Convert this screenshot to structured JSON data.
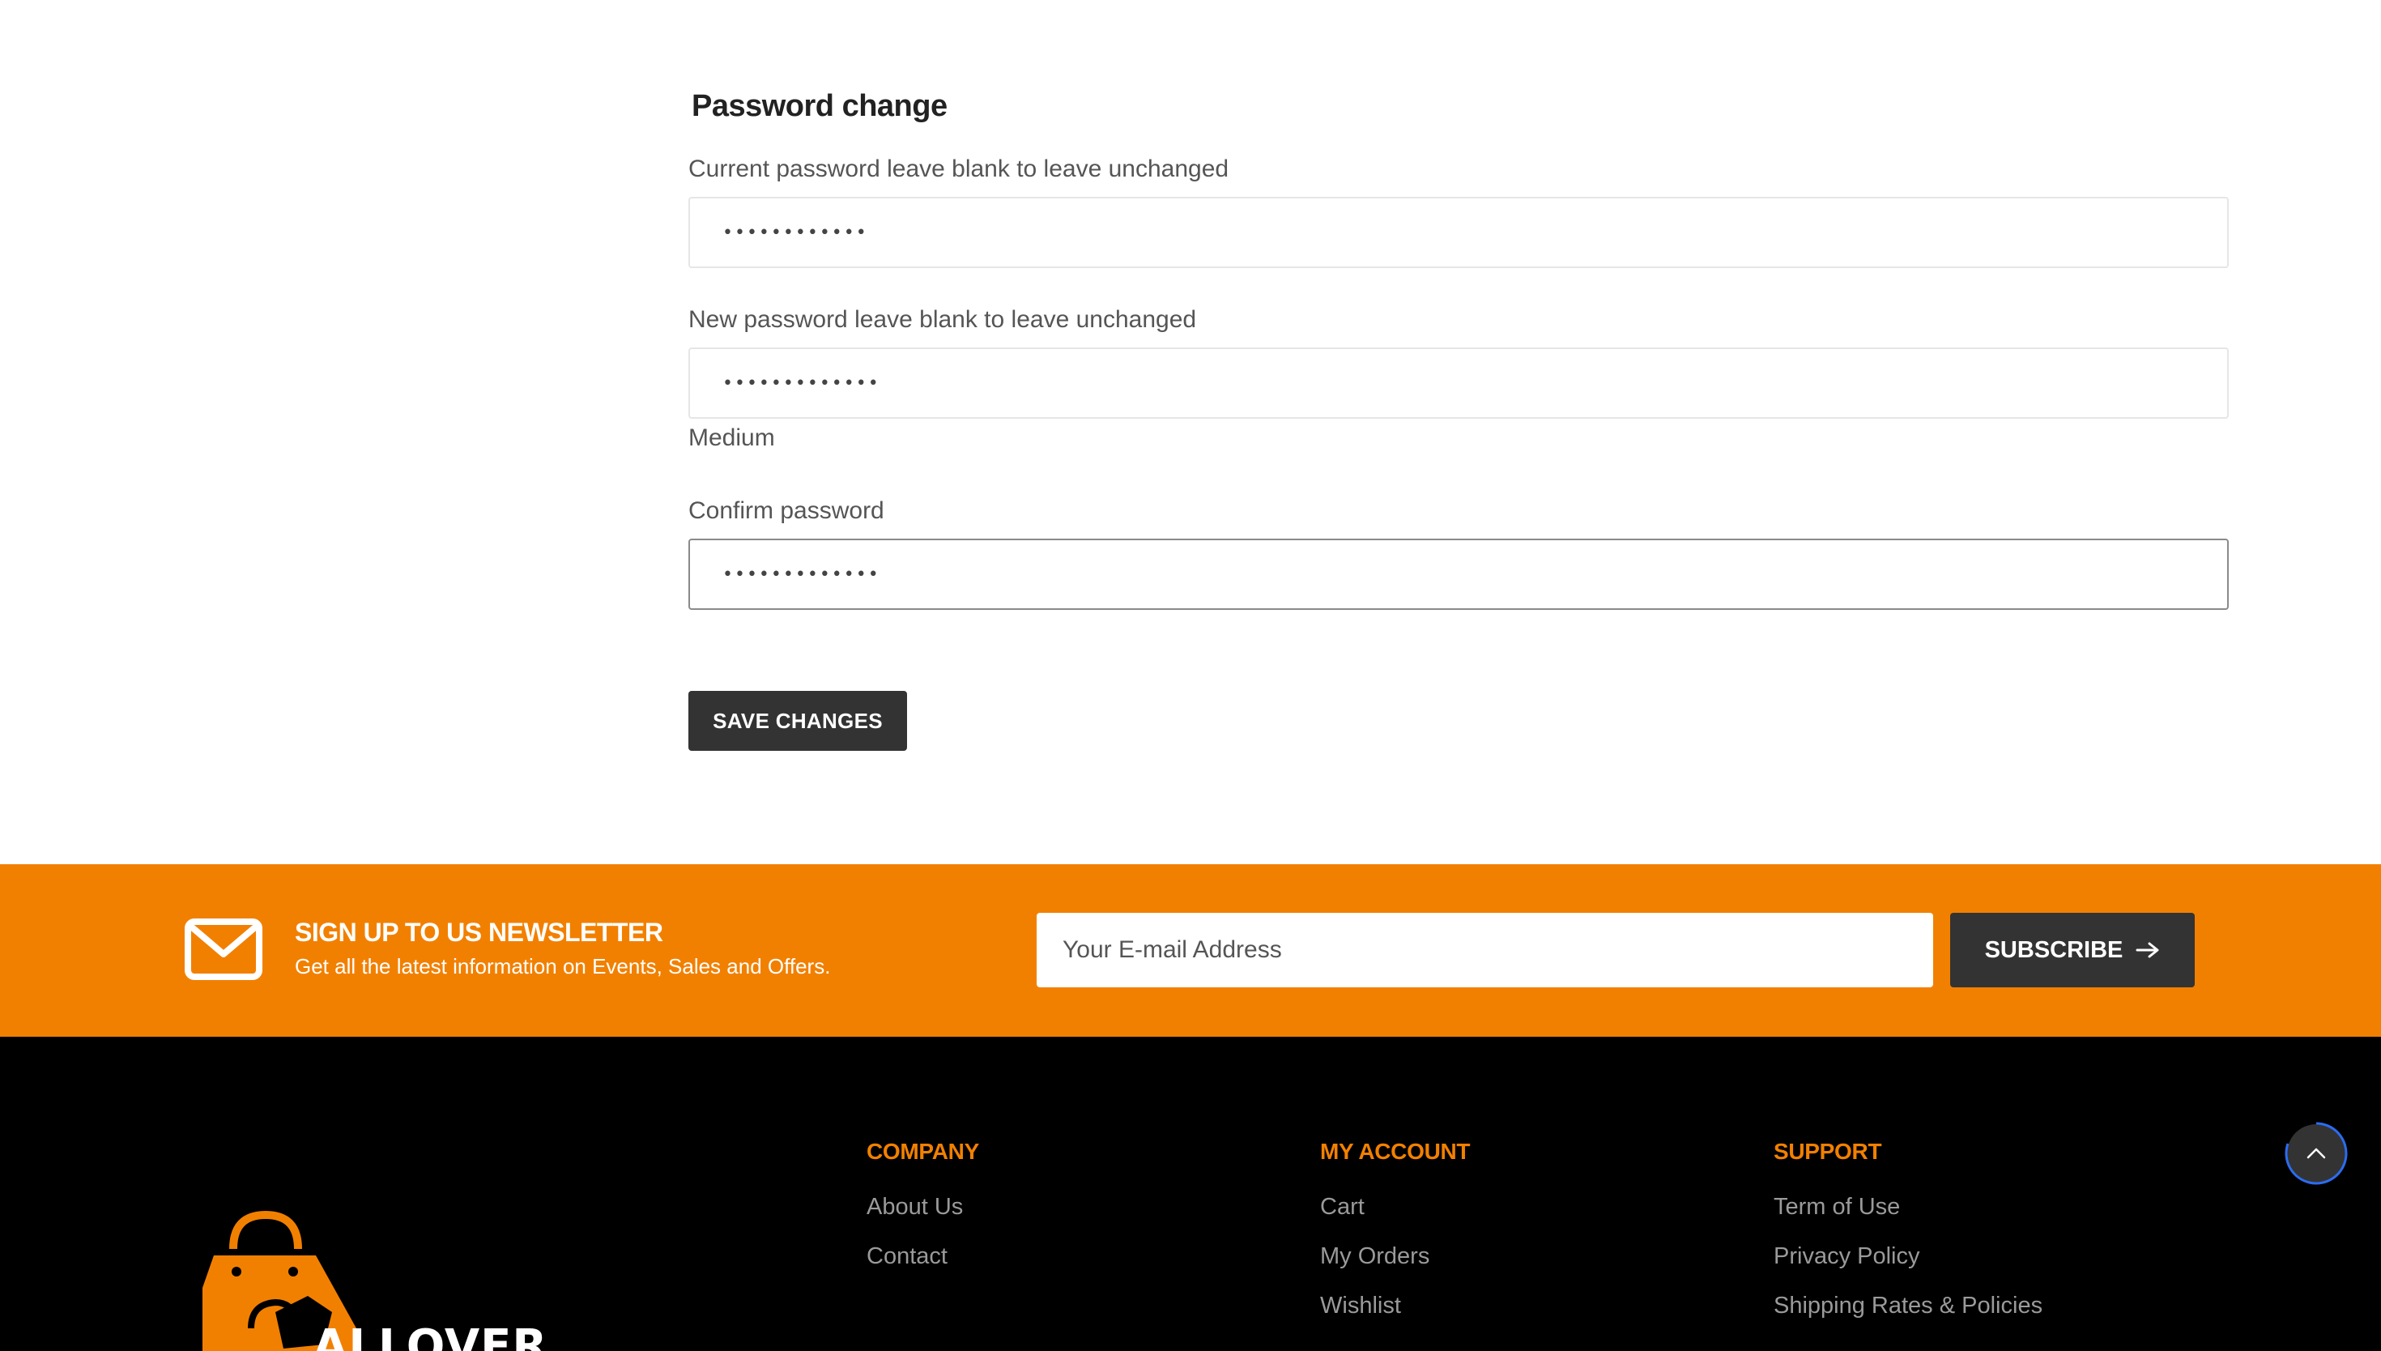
{
  "password_form": {
    "title": "Password change",
    "current_label": "Current password leave blank to leave unchanged",
    "current_value": "••••••••••••",
    "new_label": "New password leave blank to leave unchanged",
    "new_value": "•••••••••••••",
    "strength": "Medium",
    "confirm_label": "Confirm password",
    "confirm_value": "•••••••••••••",
    "save_label": "SAVE CHANGES"
  },
  "newsletter": {
    "title": "SIGN UP TO US NEWSLETTER",
    "subtitle": "Get all the latest information on Events, Sales and Offers.",
    "email_placeholder": "Your E-mail Address",
    "subscribe_label": "SUBSCRIBE",
    "icon": "envelope-icon"
  },
  "footer": {
    "logo_text": "ALLOVER",
    "company": {
      "title": "COMPANY",
      "links": [
        "About Us",
        "Contact"
      ]
    },
    "my_account": {
      "title": "MY ACCOUNT",
      "links": [
        "Cart",
        "My Orders",
        "Wishlist"
      ]
    },
    "support": {
      "title": "SUPPORT",
      "links": [
        "Term of Use",
        "Privacy Policy",
        "Shipping Rates & Policies"
      ]
    }
  },
  "colors": {
    "accent": "#f28000",
    "dark_button": "#333333",
    "footer_bg": "#000000"
  }
}
